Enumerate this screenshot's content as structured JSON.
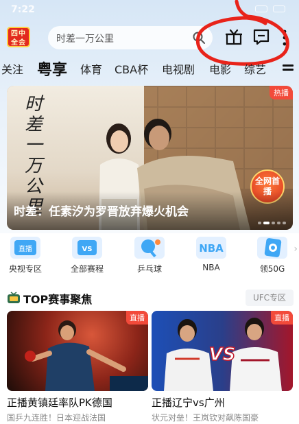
{
  "status_bar": {
    "time": "7:22"
  },
  "header": {
    "logo_text": "四中全会",
    "search_placeholder": "时差一万公里"
  },
  "tabs": [
    {
      "label": "关注"
    },
    {
      "label": "粤享"
    },
    {
      "label": "体育"
    },
    {
      "label": "CBA杯"
    },
    {
      "label": "电视剧"
    },
    {
      "label": "电影"
    },
    {
      "label": "综艺"
    }
  ],
  "banner": {
    "vertical_title": "时差一万公里",
    "hot_badge": "热播",
    "premiere_badge": "全网首播",
    "caption": "时差：任素汐为罗晋放弃爆火机会",
    "dots_total": 5,
    "dots_active": 0
  },
  "quick_entries": [
    {
      "label": "央视专区",
      "icon_text": "直播",
      "icon": "tv-live-icon"
    },
    {
      "label": "全部赛程",
      "icon_text": "VS",
      "icon": "schedule-icon"
    },
    {
      "label": "乒乓球",
      "icon_text": "",
      "icon": "ping-pong-icon"
    },
    {
      "label": "NBA",
      "icon_text": "NBA",
      "icon": "nba-icon"
    },
    {
      "label": "领50G",
      "icon_text": "",
      "icon": "data-gift-icon"
    }
  ],
  "section": {
    "title": "TOP赛事聚焦",
    "link": "UFC专区"
  },
  "cards": [
    {
      "badge": "直播",
      "title": "正播黄镇廷率队PK德国",
      "subtitle": "国乒九连胜！日本迎战法国"
    },
    {
      "badge": "直播",
      "title": "正播辽宁vs广州",
      "subtitle": "状元对垒！王岚钦对飙陈国豪",
      "vs_text": "VS"
    }
  ],
  "colors": {
    "accent_red": "#f24a3a",
    "annotation_red": "#e8231a",
    "header_bg": "#d6e6f6"
  }
}
